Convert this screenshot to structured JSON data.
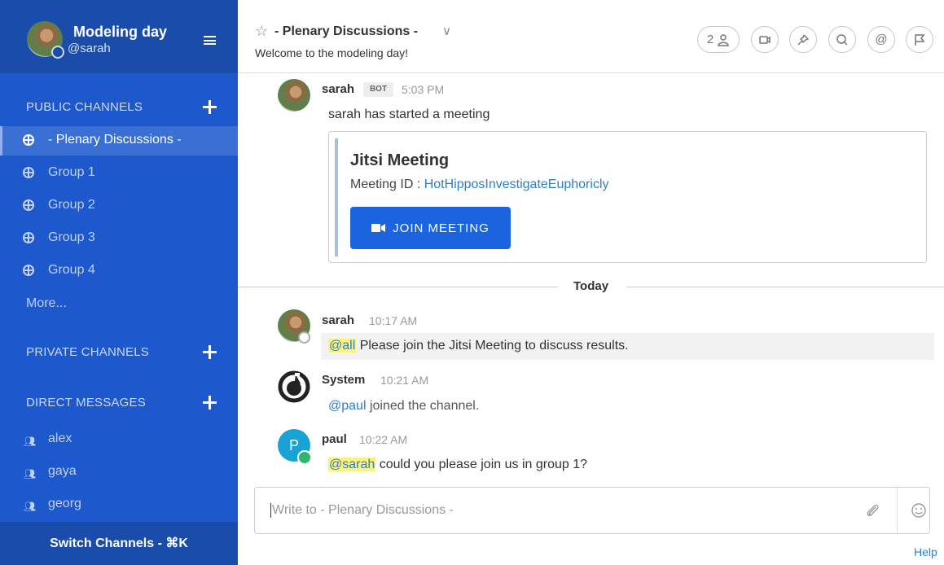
{
  "sidebar": {
    "team_name": "Modeling day",
    "username": "@sarah",
    "public_title": "PUBLIC CHANNELS",
    "private_title": "PRIVATE CHANNELS",
    "dm_title": "DIRECT MESSAGES",
    "channels": [
      {
        "label": "- Plenary Discussions -"
      },
      {
        "label": "Group 1"
      },
      {
        "label": "Group 2"
      },
      {
        "label": "Group 3"
      },
      {
        "label": "Group 4"
      }
    ],
    "more": "More...",
    "dms": [
      {
        "label": "alex"
      },
      {
        "label": "gaya"
      },
      {
        "label": "georg"
      }
    ],
    "switch_channels": "Switch Channels - ⌘K"
  },
  "header": {
    "title": "- Plenary Discussions -",
    "purpose": "Welcome to the modeling day!",
    "member_count": "2"
  },
  "messages": {
    "m1": {
      "name": "sarah",
      "badge": "BOT",
      "time": "5:03 PM",
      "text": "sarah has started a meeting",
      "card": {
        "title": "Jitsi Meeting",
        "id_label": "Meeting ID : ",
        "id_value": "HotHipposInvestigateEuphoricly",
        "button": "JOIN MEETING"
      }
    },
    "date_separator": "Today",
    "m2": {
      "name": "sarah",
      "time": "10:17 AM",
      "mention": "@all",
      "text": " Please join the Jitsi Meeting to discuss results."
    },
    "m3": {
      "name": "System",
      "time": "10:21 AM",
      "mention": "@paul",
      "text": " joined the channel."
    },
    "m4": {
      "name": "paul",
      "initial": "P",
      "time": "10:22 AM",
      "mention": "@sarah",
      "text": " could you please join us in group 1?"
    }
  },
  "input": {
    "placeholder": "Write to - Plenary Discussions -"
  },
  "help": "Help",
  "colors": {
    "sidebar": "#1d58cc",
    "sidebar_header": "#1a4dab",
    "accent": "#1b64e0",
    "mention_bg": "#fff27a",
    "link": "#2c80c7"
  }
}
